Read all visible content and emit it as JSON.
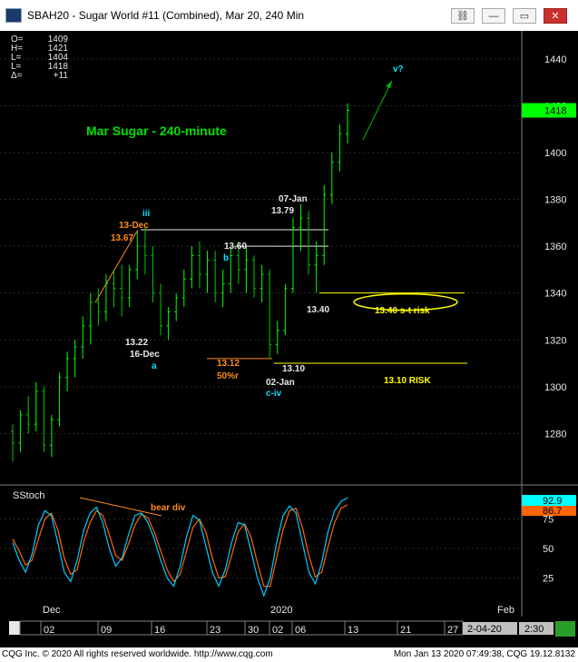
{
  "window": {
    "title": "SBAH20 - Sugar World #11 (Combined), Mar 20, 240 Min",
    "buttons": {
      "link": "⛓",
      "restore": "▭",
      "close": "✕"
    }
  },
  "ohlc": [
    {
      "k": "O=",
      "v": "1409"
    },
    {
      "k": "H=",
      "v": "1421"
    },
    {
      "k": "L=",
      "v": "1404"
    },
    {
      "k": "L=",
      "v": "1418"
    },
    {
      "k": "Δ=",
      "v": "+11"
    }
  ],
  "colors": {
    "background": "#000000",
    "up_bar": "#00ff00",
    "price_badge": "#00ff00",
    "annotation_orange": "#ff8c1a",
    "annotation_yellow": "#ffff00",
    "annotation_cyan": "#00e5ff",
    "annotation_green": "#00e000",
    "label_white": "#e8e8e8",
    "stoch_k": "#00ccff",
    "stoch_d": "#ff6600",
    "stoch_label_badge": "#00ffff"
  },
  "chart_data": {
    "type": "bar",
    "title": "Mar Sugar  - 240-minute",
    "price_axis": {
      "ticks": [
        1280,
        1300,
        1320,
        1340,
        1360,
        1380,
        1400,
        1420,
        1440
      ],
      "range": [
        1260,
        1450
      ],
      "last": "1418"
    },
    "series": [
      {
        "name": "Mar Sugar",
        "ohlc": [
          [
            1281,
            1284,
            1268,
            1276
          ],
          [
            1276,
            1290,
            1272,
            1288
          ],
          [
            1288,
            1296,
            1280,
            1284
          ],
          [
            1284,
            1302,
            1281,
            1298
          ],
          [
            1298,
            1300,
            1272,
            1275
          ],
          [
            1275,
            1288,
            1270,
            1286
          ],
          [
            1286,
            1306,
            1283,
            1304
          ],
          [
            1304,
            1315,
            1298,
            1312
          ],
          [
            1312,
            1320,
            1304,
            1317
          ],
          [
            1317,
            1330,
            1312,
            1326
          ],
          [
            1326,
            1340,
            1318,
            1336
          ],
          [
            1336,
            1342,
            1326,
            1332
          ],
          [
            1332,
            1348,
            1328,
            1344
          ],
          [
            1344,
            1350,
            1334,
            1342
          ],
          [
            1342,
            1352,
            1330,
            1338
          ],
          [
            1338,
            1352,
            1334,
            1350
          ],
          [
            1350,
            1366,
            1346,
            1360
          ],
          [
            1360,
            1368,
            1348,
            1356
          ],
          [
            1356,
            1360,
            1336,
            1340
          ],
          [
            1340,
            1344,
            1322,
            1326
          ],
          [
            1326,
            1334,
            1320,
            1332
          ],
          [
            1332,
            1340,
            1328,
            1338
          ],
          [
            1338,
            1350,
            1334,
            1346
          ],
          [
            1346,
            1360,
            1342,
            1356
          ],
          [
            1356,
            1362,
            1342,
            1348
          ],
          [
            1348,
            1358,
            1340,
            1354
          ],
          [
            1354,
            1358,
            1336,
            1340
          ],
          [
            1340,
            1350,
            1334,
            1344
          ],
          [
            1344,
            1360,
            1340,
            1356
          ],
          [
            1356,
            1362,
            1344,
            1350
          ],
          [
            1350,
            1360,
            1340,
            1354
          ],
          [
            1354,
            1356,
            1338,
            1342
          ],
          [
            1342,
            1352,
            1336,
            1348
          ],
          [
            1348,
            1350,
            1312,
            1318
          ],
          [
            1318,
            1328,
            1314,
            1324
          ],
          [
            1324,
            1344,
            1322,
            1342
          ],
          [
            1342,
            1372,
            1340,
            1368
          ],
          [
            1368,
            1378,
            1358,
            1372
          ],
          [
            1372,
            1375,
            1348,
            1352
          ],
          [
            1352,
            1362,
            1340,
            1356
          ],
          [
            1356,
            1386,
            1352,
            1382
          ],
          [
            1382,
            1400,
            1378,
            1396
          ],
          [
            1396,
            1412,
            1392,
            1408
          ],
          [
            1408,
            1421,
            1404,
            1418
          ]
        ]
      }
    ],
    "date_axis": {
      "ticks": [
        "02",
        "09",
        "16",
        "23",
        "30",
        "02",
        "06",
        "13",
        "21",
        "27"
      ],
      "months": [
        "Dec",
        "2020",
        "Feb"
      ],
      "readout": "2-04-20",
      "readout_time": "2:30"
    },
    "annotations": [
      {
        "text": "iii",
        "color": "cyan"
      },
      {
        "text": "13-Dec",
        "color": "orange"
      },
      {
        "text": "13.67",
        "color": "orange"
      },
      {
        "text": "13.60",
        "color": "white"
      },
      {
        "text": "b",
        "color": "cyan"
      },
      {
        "text": "13.22",
        "color": "white"
      },
      {
        "text": "16-Dec",
        "color": "white"
      },
      {
        "text": "a",
        "color": "cyan"
      },
      {
        "text": "13.12",
        "color": "orange"
      },
      {
        "text": "50%r",
        "color": "orange"
      },
      {
        "text": "13.10",
        "color": "white"
      },
      {
        "text": "02-Jan",
        "color": "white"
      },
      {
        "text": "c-iv",
        "color": "cyan"
      },
      {
        "text": "07-Jan",
        "color": "white"
      },
      {
        "text": "13.79",
        "color": "white"
      },
      {
        "text": "13.40",
        "color": "white"
      },
      {
        "text": "v?",
        "color": "cyan"
      },
      {
        "text": "13.40 s-t risk",
        "color": "yellow"
      },
      {
        "text": "13.10 RISK",
        "color": "yellow"
      }
    ],
    "levels": [
      {
        "name": "13.67 line",
        "value": 1367
      },
      {
        "name": "13.60 line",
        "value": 1360
      },
      {
        "name": "13.40 s-t risk",
        "value": 1340
      },
      {
        "name": "13.10 RISK",
        "value": 1310
      }
    ]
  },
  "stoch": {
    "label": "SStoch",
    "ticks": [
      25,
      50,
      75
    ],
    "range": [
      0,
      100
    ],
    "values_badge": [
      "92.9",
      "86.7"
    ],
    "note": "bear div",
    "k": [
      55,
      40,
      30,
      45,
      70,
      82,
      78,
      55,
      30,
      22,
      40,
      65,
      80,
      85,
      72,
      50,
      35,
      42,
      62,
      78,
      80,
      72,
      58,
      40,
      25,
      18,
      35,
      60,
      78,
      74,
      52,
      30,
      18,
      32,
      55,
      72,
      70,
      48,
      25,
      10,
      25,
      55,
      78,
      86,
      80,
      55,
      30,
      20,
      38,
      65,
      82,
      90,
      93
    ],
    "d": [
      58,
      48,
      36,
      40,
      58,
      75,
      80,
      66,
      42,
      28,
      32,
      55,
      72,
      82,
      78,
      62,
      44,
      40,
      54,
      70,
      79,
      76,
      64,
      48,
      32,
      22,
      28,
      48,
      68,
      75,
      64,
      42,
      25,
      26,
      44,
      64,
      71,
      60,
      38,
      18,
      18,
      42,
      66,
      82,
      84,
      68,
      44,
      26,
      30,
      52,
      72,
      84,
      87
    ]
  },
  "statusbar": {
    "left": "CQG Inc. © 2020 All rights reserved worldwide. http://www.cqg.com",
    "right": "Mon Jan 13 2020 07:49:38, CQG 19.12.8132"
  }
}
